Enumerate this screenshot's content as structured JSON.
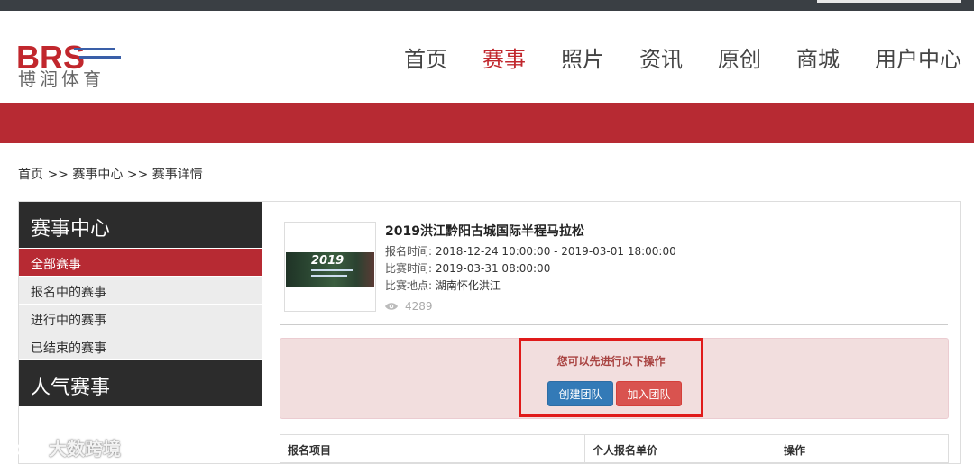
{
  "brand": {
    "logo_text": "BRS",
    "name_cn": "博润体育"
  },
  "nav": [
    {
      "label": "首页",
      "active": false
    },
    {
      "label": "赛事",
      "active": true
    },
    {
      "label": "照片",
      "active": false
    },
    {
      "label": "资讯",
      "active": false
    },
    {
      "label": "原创",
      "active": false
    },
    {
      "label": "商城",
      "active": false
    },
    {
      "label": "用户中心",
      "active": false
    }
  ],
  "breadcrumb": "首页 >> 赛事中心 >> 赛事详情",
  "sidebar": {
    "title": "赛事中心",
    "items": [
      {
        "label": "全部赛事",
        "active": true
      },
      {
        "label": "报名中的赛事",
        "active": false
      },
      {
        "label": "进行中的赛事",
        "active": false
      },
      {
        "label": "已结束的赛事",
        "active": false
      }
    ],
    "title2": "人气赛事"
  },
  "event": {
    "thumb_text": "2019",
    "title": "2019洪江黔阳古城国际半程马拉松",
    "signup_label": "报名时间:",
    "signup_value": "2018-12-24 10:00:00 - 2019-03-01 18:00:00",
    "race_label": "比赛时间:",
    "race_value": "2019-03-31 08:00:00",
    "place_label": "比赛地点:",
    "place_value": "湖南怀化洪江",
    "views": "4289"
  },
  "alert": {
    "message": "您可以先进行以下操作",
    "create_label": "创建团队",
    "join_label": "加入团队"
  },
  "table": {
    "headers": [
      "报名项目",
      "个人报名单价",
      "操作"
    ]
  },
  "watermark": "大数跨境",
  "colors": {
    "accent": "#b72a33",
    "primary_button": "#337ab7",
    "danger_button": "#d9534f"
  }
}
